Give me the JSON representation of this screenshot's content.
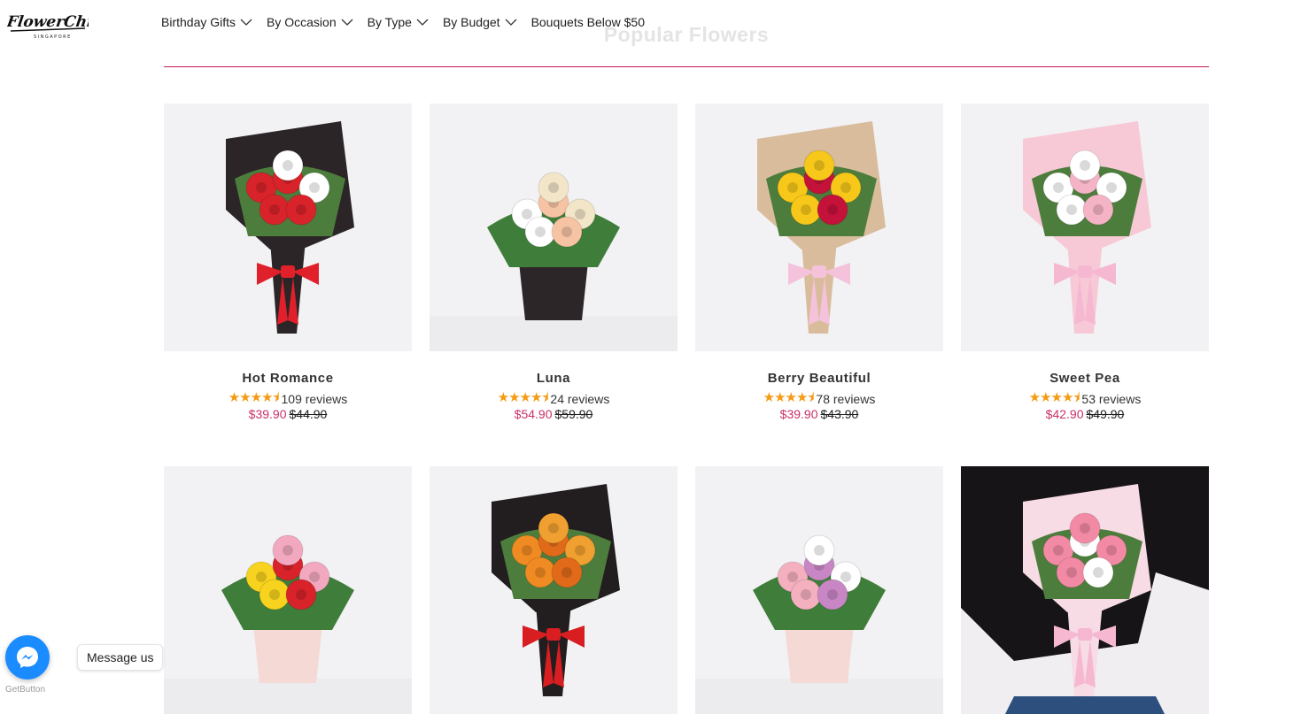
{
  "brand": {
    "logo_text": "FlowerChimp",
    "logo_subtext": "SINGAPORE"
  },
  "nav": [
    {
      "label": "Birthday Gifts",
      "has_dropdown": true
    },
    {
      "label": "By Occasion",
      "has_dropdown": true
    },
    {
      "label": "By Type",
      "has_dropdown": true
    },
    {
      "label": "By Budget",
      "has_dropdown": true
    },
    {
      "label": "Bouquets Below $50",
      "has_dropdown": false
    }
  ],
  "section": {
    "title": "Popular Flowers"
  },
  "products": [
    {
      "name": "Hot Romance",
      "rating": 4.5,
      "reviews": "109 reviews",
      "price": "$39.90",
      "original_price": "$44.90",
      "wrap": "#2b2527",
      "flowers": [
        "#d8232a",
        "#d8232a",
        "#ffffff"
      ],
      "ribbon": "#e0202a"
    },
    {
      "name": "Luna",
      "rating": 4.5,
      "reviews": "24 reviews",
      "price": "$54.90",
      "original_price": "$59.90",
      "wrap": "#2d2628",
      "flowers": [
        "#ffffff",
        "#f6c4a4",
        "#f3e6c8"
      ],
      "ribbon": ""
    },
    {
      "name": "Berry Beautiful",
      "rating": 4.5,
      "reviews": "78 reviews",
      "price": "$39.90",
      "original_price": "$43.90",
      "wrap": "#d9bc9c",
      "flowers": [
        "#f7c81a",
        "#c4123a",
        "#f7c81a"
      ],
      "ribbon": "#f5c2dc"
    },
    {
      "name": "Sweet Pea",
      "rating": 4.5,
      "reviews": "53 reviews",
      "price": "$42.90",
      "original_price": "$49.90",
      "wrap": "#f7c9d6",
      "flowers": [
        "#ffffff",
        "#f5b3c6",
        "#ffffff"
      ],
      "ribbon": "#f5b8d0"
    },
    {
      "name": "",
      "wrap": "#f5d9d4",
      "flowers": [
        "#f7d21e",
        "#d8232a",
        "#f2a9c0"
      ],
      "ribbon": ""
    },
    {
      "name": "",
      "wrap": "#221d1f",
      "flowers": [
        "#f08a22",
        "#e06a1a",
        "#f0a030"
      ],
      "ribbon": "#d81e20"
    },
    {
      "name": "",
      "wrap": "#f5d9d4",
      "flowers": [
        "#f4b0bf",
        "#c887c4",
        "#ffffff"
      ],
      "ribbon": ""
    },
    {
      "name": "",
      "wrap": "#f7dbe5",
      "flowers": [
        "#f28aa5",
        "#ffffff",
        "#f28aa5"
      ],
      "ribbon": "#f5b8d0"
    }
  ],
  "messenger": {
    "label": "Message us",
    "provider": "GetButton",
    "icon": "messenger-icon"
  },
  "colors": {
    "accent": "#c9306a",
    "star": "#f59a12",
    "messenger": "#1a8cff"
  }
}
